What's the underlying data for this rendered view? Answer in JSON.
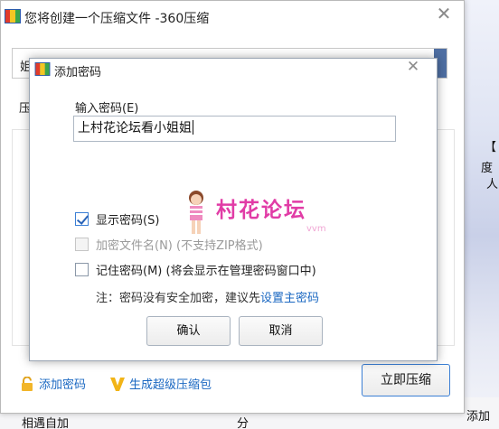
{
  "main_window": {
    "title": "您将创建一个压缩文件 -360压缩",
    "path_value": "姐",
    "side_label": "压",
    "add_password_label": "添加密码",
    "super_package_label": "生成超级压缩包",
    "compress_button_label": "立即压缩",
    "partial_text_left": "相遇自加",
    "partial_text_right": "分",
    "icons": [
      "archive-icon",
      "close-icon",
      "lock-icon",
      "v-badge-icon"
    ]
  },
  "background": {
    "right_text_1": "【",
    "right_text_2": "度",
    "right_text_3": "人",
    "right_text_4": "添加"
  },
  "dialog": {
    "title": "添加密码",
    "password_label": "输入密码(E)",
    "password_value": "上村花论坛看小姐姐",
    "watermark_text": "村花论坛",
    "watermark_sub": "vvm",
    "options": [
      {
        "label": "显示密码(S)",
        "checked": true,
        "disabled": false
      },
      {
        "label": "加密文件名(N) (不支持ZIP格式)",
        "checked": false,
        "disabled": true
      },
      {
        "label": "记住密码(M) (将会显示在管理密码窗口中)",
        "checked": false,
        "disabled": false
      }
    ],
    "note_prefix": "注：密码没有安全加密，建议先",
    "note_link": "设置主密码",
    "ok_label": "确认",
    "cancel_label": "取消",
    "icons": [
      "archive-icon",
      "close-icon",
      "checkmark-icon"
    ]
  },
  "colors": {
    "link": "#1b68c2",
    "accent_border": "#3b7fd5",
    "watermark": "#e13ca6"
  }
}
